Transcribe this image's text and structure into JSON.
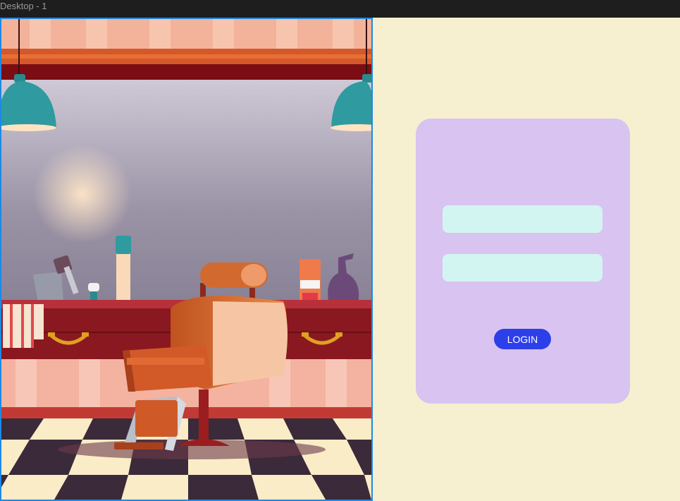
{
  "window": {
    "title": "Desktop - 1"
  },
  "login_card": {
    "username_placeholder": "",
    "password_placeholder": "",
    "login_label": "LOGIN"
  },
  "colors": {
    "page_background": "#f6f0d0",
    "card_background": "#d9c3f1",
    "field_background": "#d3f5f2",
    "button_background": "#2d3fe8",
    "selection_border": "#1e88e5"
  }
}
